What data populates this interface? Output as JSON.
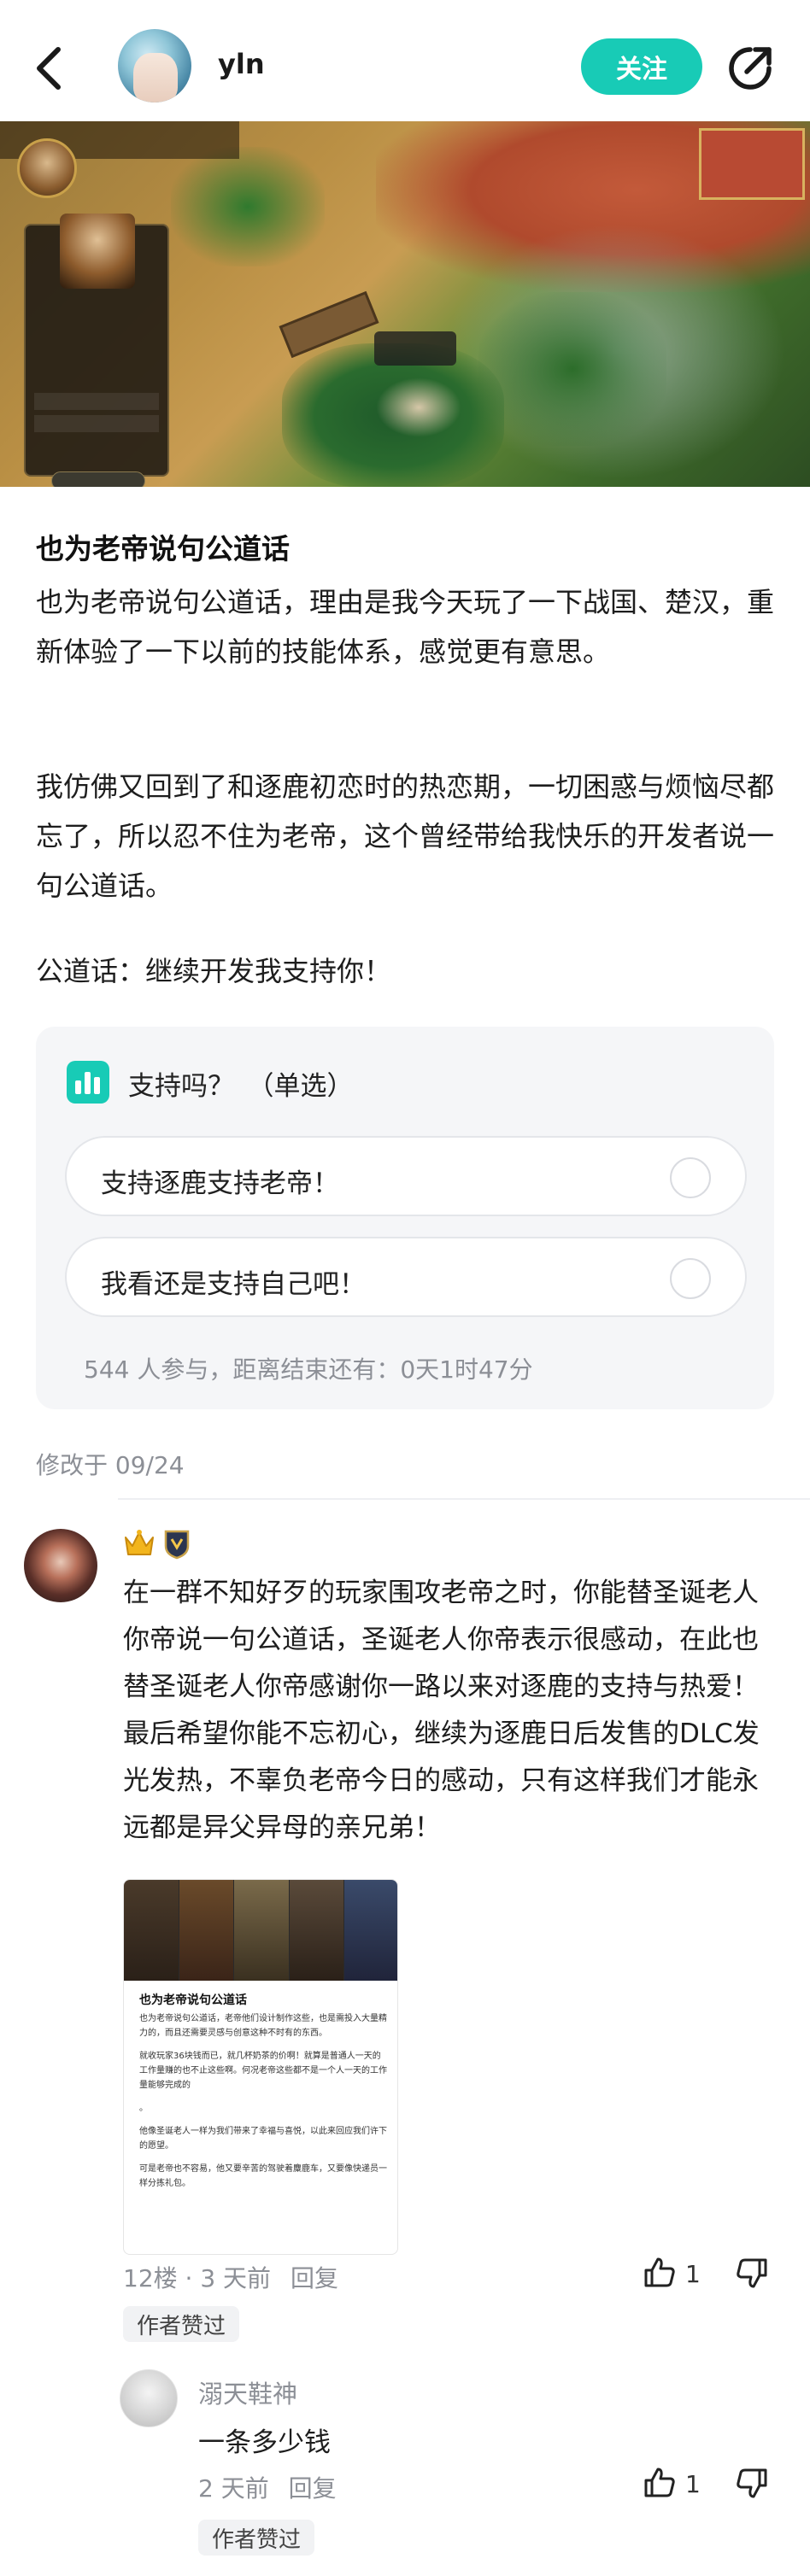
{
  "header": {
    "username": "yln",
    "follow_label": "关注"
  },
  "post": {
    "title": "也为老帝说句公道话",
    "paragraphs": [
      "也为老帝说句公道话，理由是我今天玩了一下战国、楚汉，重新体验了一下以前的技能体系，感觉更有意思。",
      "我仿佛又回到了和逐鹿初恋时的热恋期，一切困惑与烦恼尽都忘了，所以忍不住为老帝，这个曾经带给我快乐的开发者说一句公道话。",
      "公道话：继续开发我支持你！"
    ],
    "modified": "修改于 09/24"
  },
  "poll": {
    "question": "支持吗？　（单选）",
    "options": [
      "支持逐鹿支持老帝！",
      "我看还是支持自己吧！"
    ],
    "stats": "544 人参与，距离结束还有：0天1时47分"
  },
  "comments": [
    {
      "text": "在一群不知好歹的玩家围攻老帝之时，你能替圣诞老人你帝说一句公道话，圣诞老人你帝表示很感动，在此也替圣诞老人你帝感谢你一路以来对逐鹿的支持与热爱！最后希望你能不忘初心，继续为逐鹿日后发售的DLC发光发热，不辜负老帝今日的感动，只有这样我们才能永远都是异父异母的亲兄弟！",
      "meta": "12楼 · 3 天前",
      "reply_label": "回复",
      "likes": "1",
      "badge": "作者赞过",
      "image": {
        "title": "也为老帝说句公道话",
        "paragraphs": [
          "也为老帝说句公道话，老帝他们设计制作这些，也是需投入大量精力的，而且还需要灵感与创意这种不时有的东西。",
          "就收玩家36块钱而已，就几杯奶茶的价啊！就算是普通人一天的工作量赚的也不止这些啊。何况老帝这些都不是一个人一天的工作量能够完成的",
          "。",
          "他像圣诞老人一样为我们带来了幸福与喜悦，以此来回应我们许下的愿望。",
          "可是老帝也不容易，他又要辛苦的驾驶着麋鹿车，又要像快递员一样分拣礼包。"
        ]
      }
    }
  ],
  "replies": [
    {
      "name": "溺天鞋神",
      "text": "一条多少钱",
      "meta": "2 天前",
      "reply_label": "回复",
      "likes": "1",
      "badge": "作者赞过"
    }
  ],
  "colors": {
    "accent": "#18cbb6",
    "muted": "#8c8f96"
  }
}
